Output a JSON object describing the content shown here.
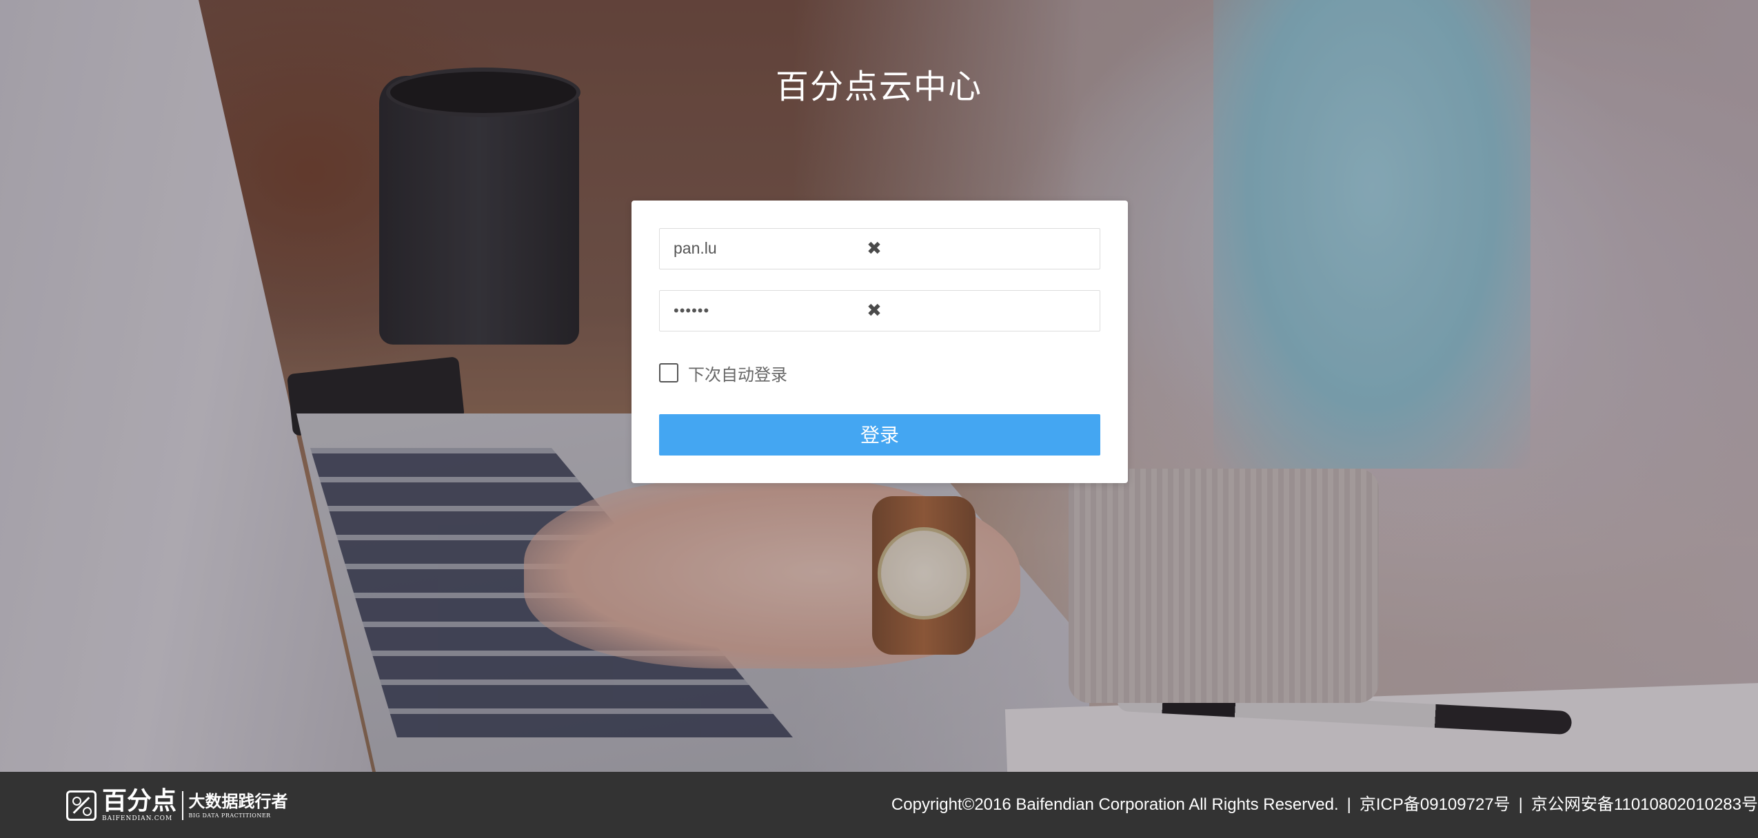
{
  "page": {
    "title": "百分点云中心"
  },
  "login": {
    "username_value": "pan.lu",
    "password_value": "••••••",
    "clear_icon": "✖",
    "remember_label": "下次自动登录",
    "remember_checked": false,
    "submit_label": "登录",
    "accent_color": "#44a6f2"
  },
  "footer": {
    "logo": {
      "brand_name": "百分点",
      "brand_domain": "BAIFENDIAN.COM",
      "slogan": "大数据践行者",
      "slogan_en": "BIG DATA PRACTITIONER"
    },
    "copyright": "Copyright©2016 Baifendian Corporation All Rights Reserved.",
    "separator": "|",
    "icp": "京ICP备09109727号",
    "police_record": "京公网安备11010802010283号"
  }
}
